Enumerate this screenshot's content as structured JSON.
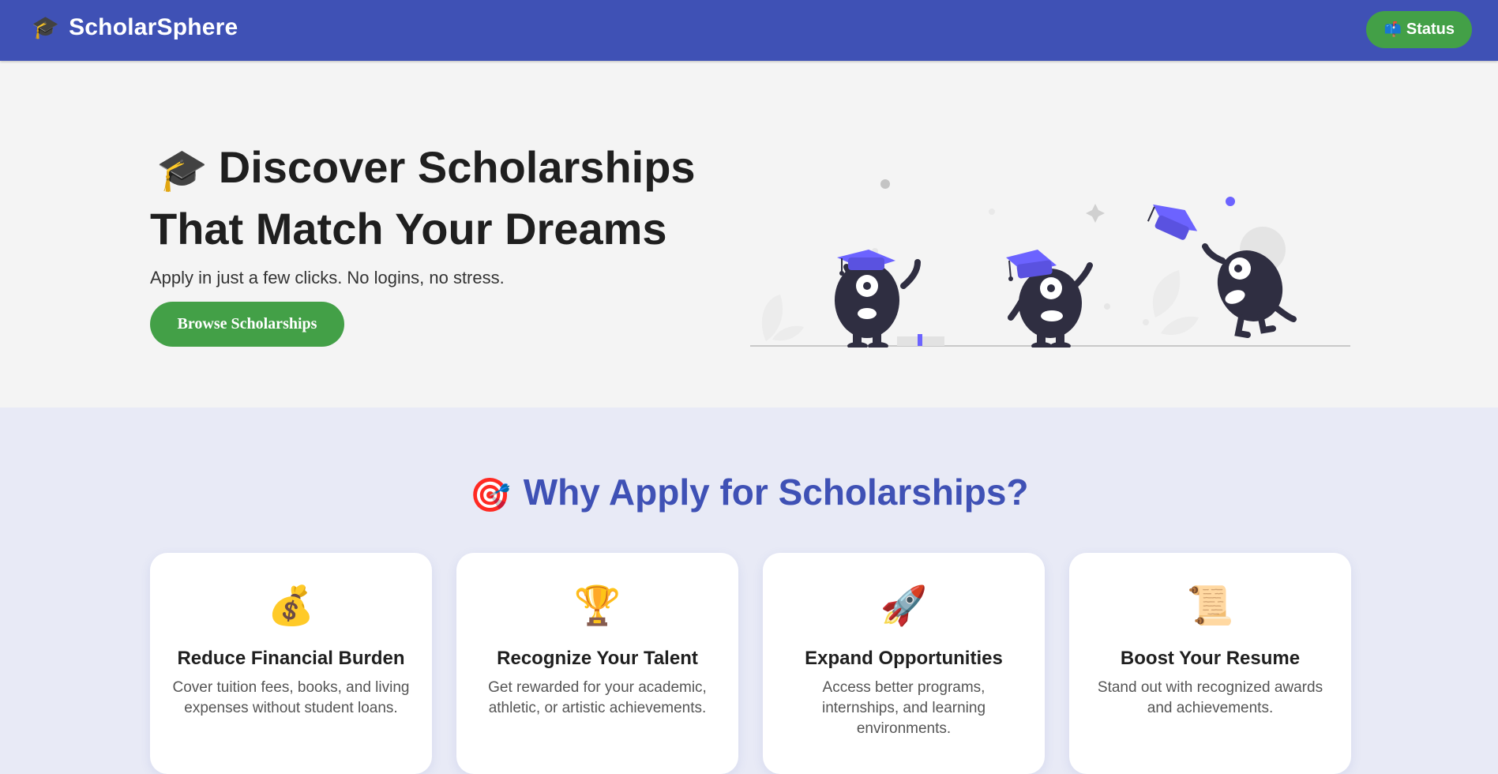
{
  "header": {
    "brand_icon": "graduation-cap-icon",
    "brand_name": "ScholarSphere",
    "status_icon": "mailbox-icon",
    "status_label": "Status"
  },
  "hero": {
    "title_icon": "graduation-cap-icon",
    "title_line1": "Discover Scholarships",
    "title_line2": "That Match Your Dreams",
    "subtitle": "Apply in just a few clicks. No logins, no stress.",
    "cta_label": "Browse Scholarships",
    "illustration": "graduation-celebration-illustration"
  },
  "why": {
    "title_icon": "target-icon",
    "title": "Why Apply for Scholarships?",
    "cards": [
      {
        "icon": "money-bag-icon",
        "title": "Reduce Financial Burden",
        "description": "Cover tuition fees, books, and living expenses without student loans."
      },
      {
        "icon": "trophy-icon",
        "title": "Recognize Your Talent",
        "description": "Get rewarded for your academic, athletic, or artistic achievements."
      },
      {
        "icon": "rocket-icon",
        "title": "Expand Opportunities",
        "description": "Access better programs, internships, and learning environments."
      },
      {
        "icon": "scroll-icon",
        "title": "Boost Your Resume",
        "description": "Stand out with recognized awards and achievements."
      }
    ]
  },
  "colors": {
    "primary": "#3f51b5",
    "accent": "#43a047",
    "hero_bg": "#f4f4f4",
    "section_bg": "#e8eaf6",
    "illustration_purple": "#6c63ff",
    "illustration_dark": "#2f2e41"
  }
}
